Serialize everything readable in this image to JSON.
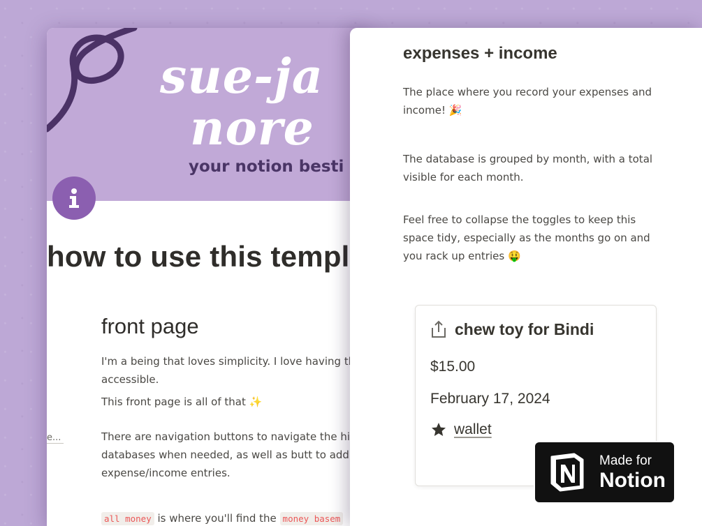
{
  "cover": {
    "title_line1": "sue-ja",
    "title_line2": "nore",
    "tagline": "your notion besti"
  },
  "left_page": {
    "title": "how to use this templa",
    "section_heading": "front page",
    "paragraph1": "I'm a being that loves simplicity. I love having th accessible.",
    "paragraph2": "This front page is all of that",
    "paragraph3": "There are navigation buttons to navigate the hidden databases when needed, as well as butt to add new expense/income entries.",
    "code_all_money": "all money",
    "paragraph4_text": "is where you'll find the",
    "code_money_base": "money basem",
    "stub_text": "e..."
  },
  "side_panel": {
    "title": "expenses + income",
    "paragraph1": "The place where you record your expenses and income! 🎉",
    "paragraph2": "The database is grouped by month, with a total visible for each month.",
    "paragraph3": "Feel free to collapse the toggles to keep this space tidy, especially as the months go on and you rack up entries 🤑"
  },
  "card": {
    "title": "chew toy for Bindi",
    "amount": "$15.00",
    "date": "February 17, 2024",
    "tag": "wallet",
    "icon": "share-icon",
    "tag_icon": "star-icon"
  },
  "badge": {
    "small": "Made for",
    "big": "Notion"
  },
  "colors": {
    "background": "#bda8d6",
    "cover": "#c1a9d7",
    "page_icon": "#8b5fb0",
    "code_text": "#eb5757"
  }
}
